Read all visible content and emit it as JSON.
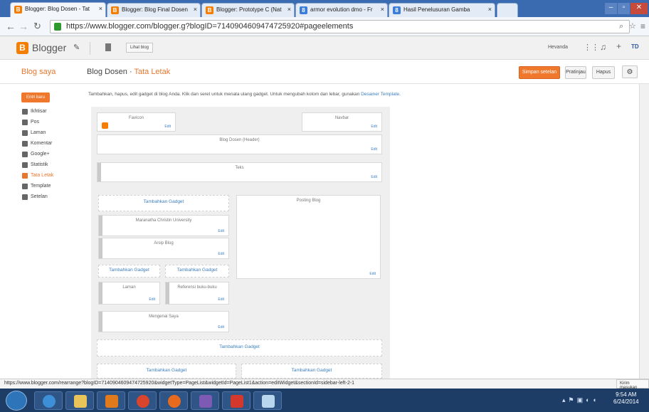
{
  "browser": {
    "tabs": [
      {
        "label": "Blogger: Blog Dosen - Tat",
        "icon": "blogger-icon"
      },
      {
        "label": "Blogger: Blog Final Dosen",
        "icon": "blogger-icon"
      },
      {
        "label": "Blogger: Prototype C (Nat",
        "icon": "blogger-icon"
      },
      {
        "label": "armor evolution dmo - Fr",
        "icon": "google-icon"
      },
      {
        "label": "Hasil Penelusuran Gamba",
        "icon": "google-icon"
      }
    ],
    "url": "https://www.blogger.com/blogger.g?blogID=7140904609474725920#pageelements"
  },
  "header": {
    "app_title": "Blogger",
    "view_blog": "Lihat blog",
    "user": "Hevanda"
  },
  "subheader": {
    "my_blogs": "Blog saya",
    "blog_name": "Blog Dosen",
    "separator": "·",
    "page_name": "Tata Letak",
    "buttons": {
      "save": "Simpan setelan",
      "preview": "Pratinjau",
      "delete": "Hapus"
    }
  },
  "sidebar": {
    "new_post": "Entri baru",
    "items": [
      {
        "label": "Ikhtisar",
        "icon": "home-icon"
      },
      {
        "label": "Pos",
        "icon": "posts-icon"
      },
      {
        "label": "Laman",
        "icon": "pages-icon"
      },
      {
        "label": "Komentar",
        "icon": "comments-icon"
      },
      {
        "label": "Google+",
        "icon": "googleplus-icon"
      },
      {
        "label": "Statistik",
        "icon": "stats-icon"
      },
      {
        "label": "Tata Letak",
        "icon": "layout-icon",
        "selected": true
      },
      {
        "label": "Template",
        "icon": "template-icon"
      },
      {
        "label": "Setelan",
        "icon": "settings-icon"
      }
    ]
  },
  "main": {
    "description": "Tambahkan, hapus, edit gadget di blog Anda. Klik dan seret untuk menata ulang gadget. Untuk mengubah kolom dan lebar, gunakan",
    "designer_link": "Desainer Template",
    "period": ".",
    "edit_label": "Edit",
    "add_gadget": "Tambahkan Gadget",
    "gadgets": {
      "favicon": "Favicon",
      "navbar": "Navbar",
      "header": "Blog Dosen (Header)",
      "text": "Teks",
      "posts": "Posting Blog",
      "maranatha": "Maranatha Christin University",
      "archive": "Arsip Blog",
      "pages": "Laman",
      "books": "Referensi buku-buku",
      "about": "Mengenai Saya"
    }
  },
  "status_bar": "https://www.blogger.com/rearrange?blogID=7140904609474725920&widgetType=PageList&widgetId=PageList1&action=editWidget&sectionId=sidebar-left-2-1",
  "send_feedback": "Kirim masukan",
  "taskbar": {
    "time": "9:54 AM",
    "date": "6/24/2014"
  },
  "colors": {
    "accent": "#f0782d",
    "link": "#3d7fc1",
    "tabbar": "#3a6ab0",
    "taskbar": "#1d3d67"
  }
}
